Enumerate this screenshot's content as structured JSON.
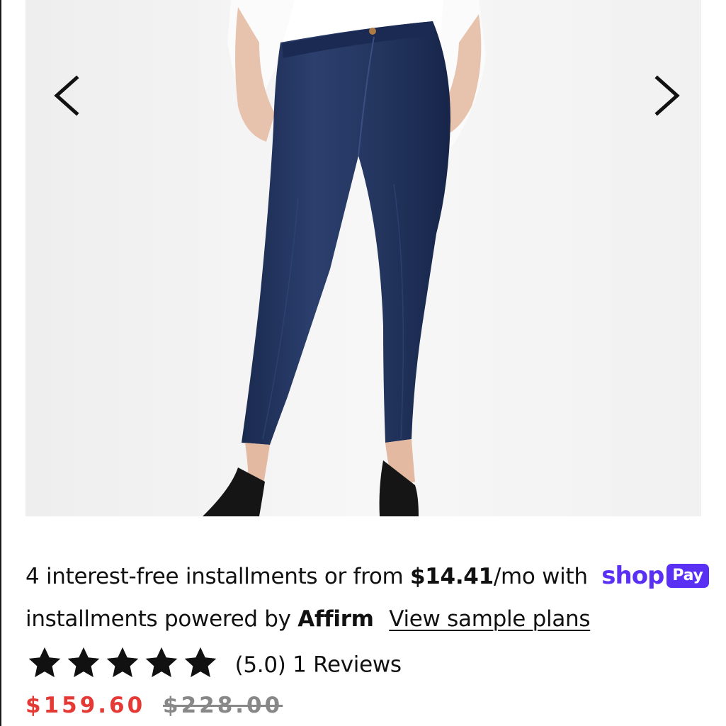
{
  "gallery": {
    "image_alt": "Model wearing dark wash skinny maternity jeans with black heels",
    "prev_icon": "chevron-left-icon",
    "next_icon": "chevron-right-icon"
  },
  "installments": {
    "prefix": "4 interest-free installments or from",
    "amount": "$14.41",
    "suffix": "/mo with",
    "shop_word": "shop",
    "pay_word": "Pay",
    "brand_color": "#5a31f4"
  },
  "affirm": {
    "prefix": "installments powered by",
    "brand": "Affirm",
    "link": "View sample plans"
  },
  "rating": {
    "stars": 5,
    "score": "(5.0)",
    "reviews": "1 Reviews",
    "star_icon": "star-icon"
  },
  "price": {
    "sale": "$159.60",
    "original": "$228.00",
    "sale_color": "#e53935"
  }
}
